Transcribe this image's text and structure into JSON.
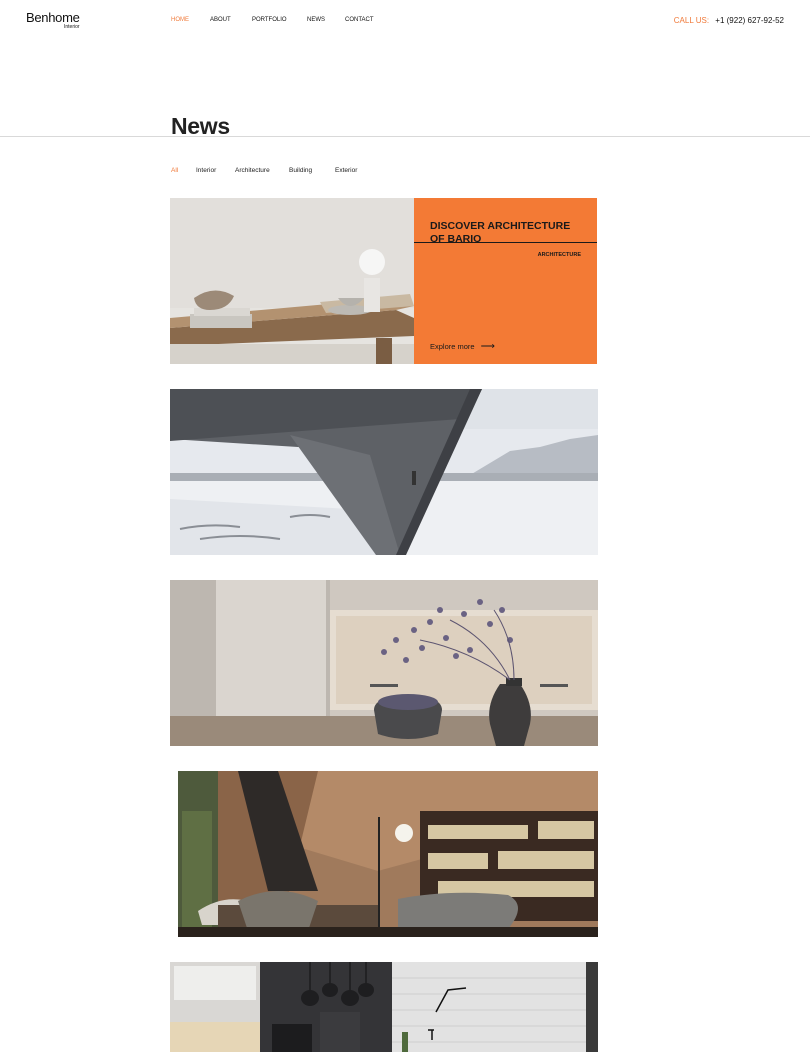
{
  "header": {
    "logo_main": "Benhome",
    "logo_sub": "Interior",
    "nav": [
      {
        "label": "HOME",
        "active": true
      },
      {
        "label": "ABOUT",
        "active": false
      },
      {
        "label": "PORTFOLIO",
        "active": false
      },
      {
        "label": "NEWS",
        "active": false
      },
      {
        "label": "CONTACT",
        "active": false
      }
    ],
    "call_label": "CALL US:",
    "phone": "+1 (922) 627-92-52"
  },
  "page": {
    "title": "News"
  },
  "filters": [
    {
      "label": "All",
      "active": true
    },
    {
      "label": "Interior",
      "active": false
    },
    {
      "label": "Architecture",
      "active": false
    },
    {
      "label": "Building",
      "active": false
    },
    {
      "label": "Exterior",
      "active": false
    }
  ],
  "featured": {
    "title": "DISCOVER ARCHITECTURE OF BARIO",
    "tag": "ARCHITECTURE",
    "cta": "Explore more",
    "arrow": "⟶"
  },
  "colors": {
    "accent": "#f37a35"
  }
}
